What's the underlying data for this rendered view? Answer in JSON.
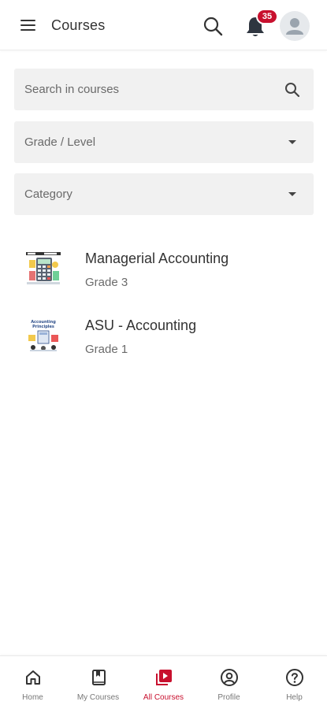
{
  "header": {
    "title": "Courses",
    "notification_count": "35"
  },
  "filters": {
    "search_placeholder": "Search in courses",
    "grade_label": "Grade / Level",
    "category_label": "Category"
  },
  "courses": [
    {
      "title": "Managerial Accounting",
      "subtitle": "Grade 3",
      "icon": "calculator-thumbnail"
    },
    {
      "title": "ASU - Accounting",
      "subtitle": "Grade 1",
      "icon": "accounting-principles-thumbnail",
      "thumb_text": "Accounting Principles"
    }
  ],
  "nav": {
    "items": [
      {
        "label": "Home",
        "icon": "home-icon"
      },
      {
        "label": "My Courses",
        "icon": "book-icon"
      },
      {
        "label": "All Courses",
        "icon": "play-library-icon",
        "active": true
      },
      {
        "label": "Profile",
        "icon": "user-circle-icon"
      },
      {
        "label": "Help",
        "icon": "help-circle-icon"
      }
    ]
  },
  "colors": {
    "accent": "#c8102e",
    "field_bg": "#f1f1f1",
    "text": "#333333"
  }
}
